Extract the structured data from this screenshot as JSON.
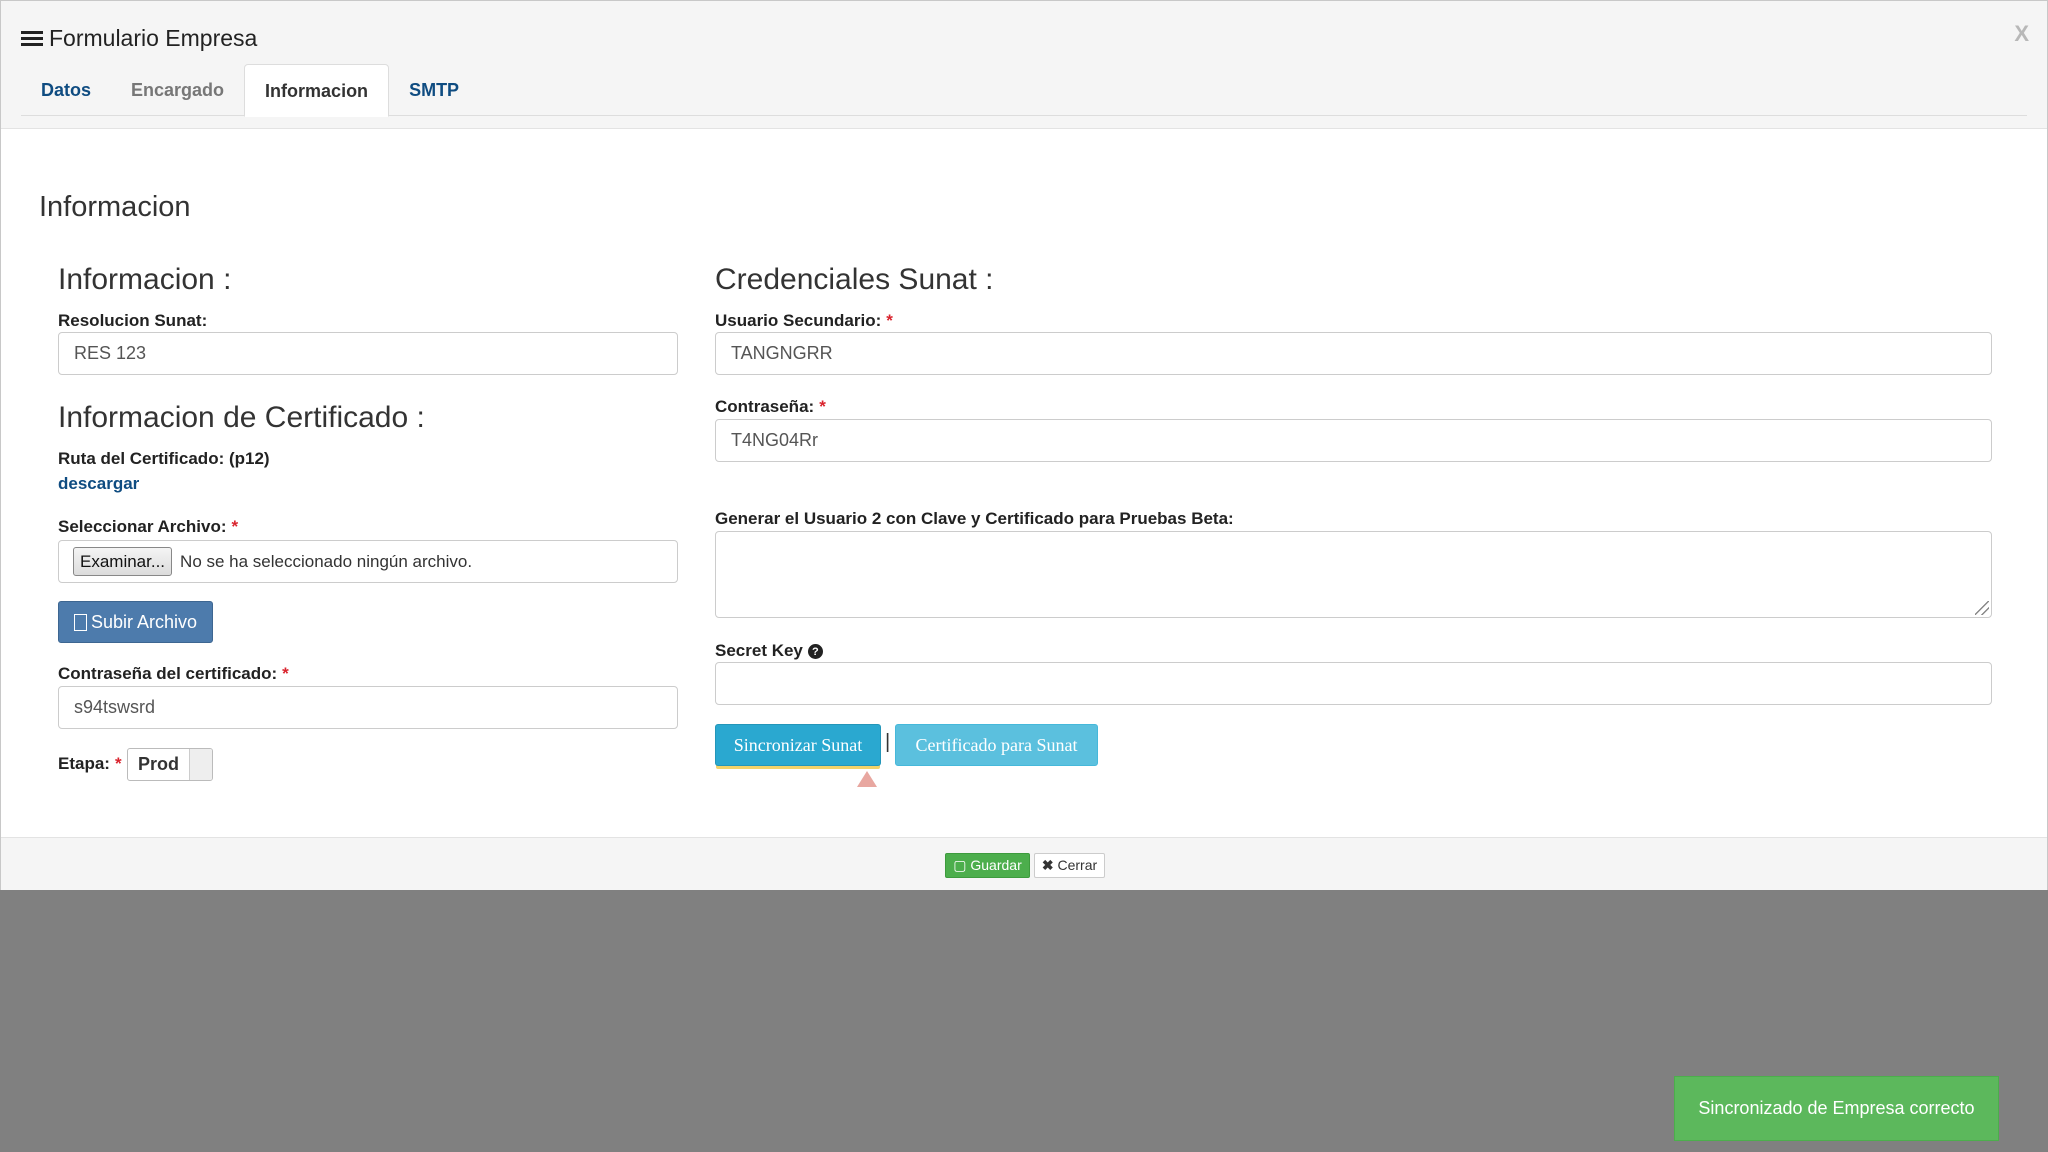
{
  "modal": {
    "title": "Formulario Empresa",
    "close_label": "X",
    "tabs": [
      {
        "label": "Datos"
      },
      {
        "label": "Encargado"
      },
      {
        "label": "Informacion"
      },
      {
        "label": "SMTP"
      }
    ],
    "section_title": "Informacion"
  },
  "left": {
    "info_heading": "Informacion :",
    "resolucion_label": "Resolucion Sunat:",
    "resolucion_value": "RES 123",
    "cert_heading": "Informacion de Certificado :",
    "ruta_label": "Ruta del Certificado: (p12)",
    "descargar_link": "descargar",
    "file_label": "Seleccionar Archivo:",
    "file_button": "Examinar...",
    "file_status": "No se ha seleccionado ningún archivo.",
    "upload_button": "Subir Archivo",
    "cert_password_label": "Contraseña del certificado:",
    "cert_password_value": "s94tswsrd",
    "etapa_label": "Etapa:",
    "etapa_value": "Prod"
  },
  "right": {
    "heading": "Credenciales Sunat :",
    "usuario_label": "Usuario Secundario:",
    "usuario_value": "TANGNGRR",
    "password_label": "Contraseña:",
    "password_value": "T4NG04Rr",
    "beta_label": "Generar el Usuario 2 con Clave y Certificado para Pruebas Beta:",
    "beta_value": "",
    "secret_label": "Secret Key",
    "secret_value": "",
    "sync_button": "Sincronizar Sunat",
    "separator": "|",
    "cert_button": "Certificado para Sunat"
  },
  "footer": {
    "save_button": "Guardar",
    "close_button": "Cerrar"
  },
  "toast": {
    "message": "Sincronizado de Empresa correcto",
    "color": "#5cb85c"
  },
  "colors": {
    "tab_link": "#0f4c81",
    "required": "#d9232d",
    "upload": "#4d7bac",
    "sync": "#2aa8d0",
    "cert": "#5bc0de",
    "save": "#4cae4c",
    "backdrop": "#808080"
  }
}
